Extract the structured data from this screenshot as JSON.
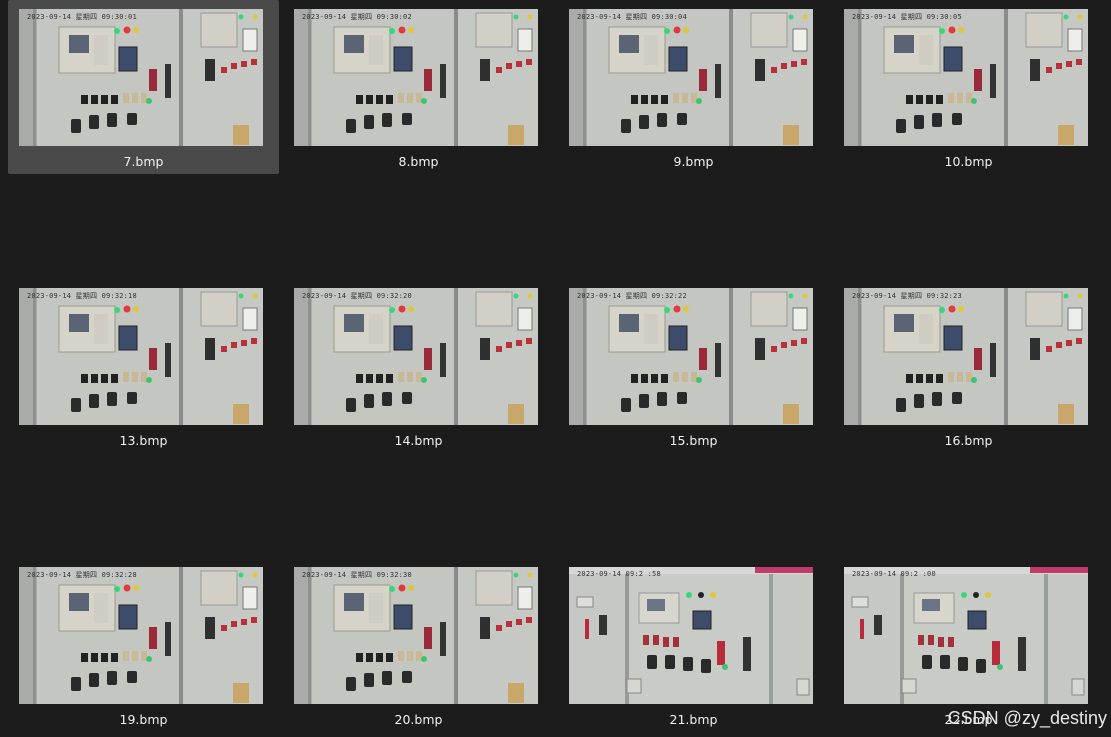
{
  "files": [
    {
      "name": "7.bmp",
      "stamp": "2023-09-14 星期四 09:30:01",
      "variant": "a",
      "selected": true
    },
    {
      "name": "8.bmp",
      "stamp": "2023-09-14 星期四 09:30:02",
      "variant": "a"
    },
    {
      "name": "9.bmp",
      "stamp": "2023-09-14 星期四 09:30:04",
      "variant": "a"
    },
    {
      "name": "10.bmp",
      "stamp": "2023-09-14 星期四 09:30:05",
      "variant": "a"
    },
    {
      "name": "13.bmp",
      "stamp": "2023-09-14 星期四 09:32:18",
      "variant": "a"
    },
    {
      "name": "14.bmp",
      "stamp": "2023-09-14 星期四 09:32:20",
      "variant": "a"
    },
    {
      "name": "15.bmp",
      "stamp": "2023-09-14 星期四 09:32:22",
      "variant": "a"
    },
    {
      "name": "16.bmp",
      "stamp": "2023-09-14 星期四 09:32:23",
      "variant": "a"
    },
    {
      "name": "19.bmp",
      "stamp": "2023-09-14 星期四 09:32:28",
      "variant": "a"
    },
    {
      "name": "20.bmp",
      "stamp": "2023-09-14 星期四 09:32:30",
      "variant": "a"
    },
    {
      "name": "21.bmp",
      "stamp": "2023-09-14 09:2 :58",
      "variant": "b"
    },
    {
      "name": "22.bmp",
      "stamp": "2023-09-14 09:2 :00",
      "variant": "b"
    }
  ],
  "watermark": "CSDN @zy_destiny"
}
